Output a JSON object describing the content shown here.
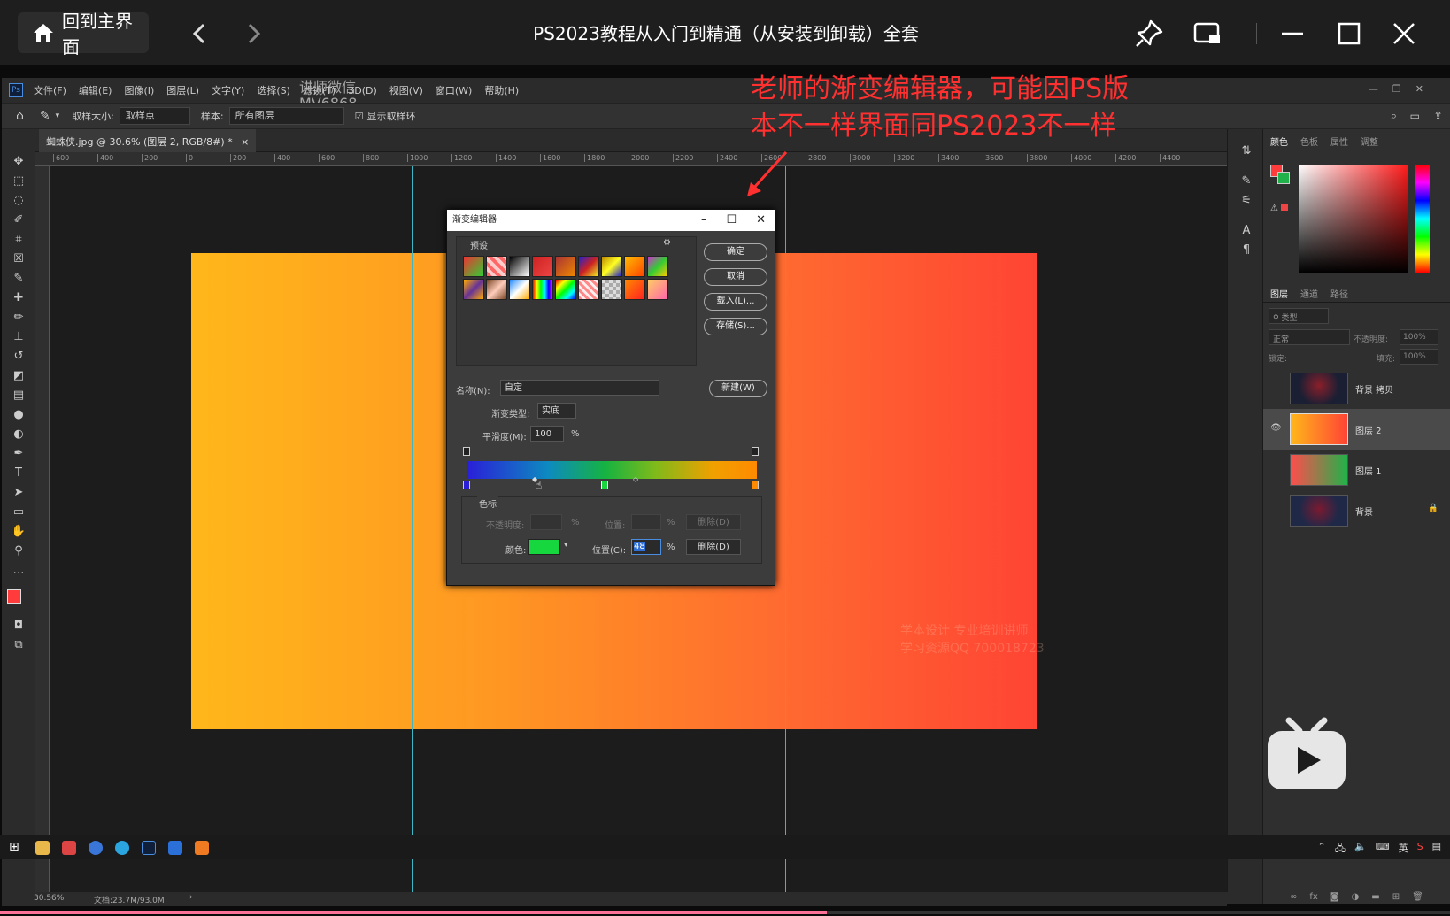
{
  "player": {
    "home_label": "回到主界面",
    "title": "PS2023教程从入门到精通（从安装到卸载）全套",
    "back_glyph": "‹",
    "forward_glyph": "›",
    "icons": [
      "home-icon",
      "chevron-left-icon",
      "chevron-right-icon",
      "pin-icon",
      "picture-in-picture-icon",
      "minimize-icon",
      "maximize-icon",
      "close-icon"
    ],
    "progress": 0.57
  },
  "annotation": {
    "line1": "老师的渐变编辑器，可能因PS版",
    "line2": "本不一样界面同PS2023不一样",
    "color": "#ff3030"
  },
  "ps": {
    "menu": [
      "文件(F)",
      "编辑(E)",
      "图像(I)",
      "图层(L)",
      "文字(Y)",
      "选择(S)",
      "滤镜(T)",
      "3D(D)",
      "视图(V)",
      "窗口(W)",
      "帮助(H)"
    ],
    "watermark": "讲师微信",
    "watermark2": "MV6868",
    "options": {
      "sample_size_label": "取样大小:",
      "sample_size_value": "取样点",
      "sample_label": "样本:",
      "sample_value": "所有图层",
      "show_ring": "显示取样环"
    },
    "doc_tab": "蜘蛛侠.jpg @ 30.6% (图层 2, RGB/8#) *",
    "ruler_ticks": [
      "600",
      "400",
      "200",
      "0",
      "200",
      "400",
      "600",
      "800",
      "1000",
      "1200",
      "1400",
      "1600",
      "1800",
      "2000",
      "2200",
      "2400",
      "2600",
      "2800",
      "3000",
      "3200",
      "3400",
      "3600",
      "3800",
      "4000",
      "4200",
      "4400"
    ],
    "status_zoom": "30.56%",
    "status_doc": "文档:23.7M/93.0M",
    "faint_watermark1": "学本设计 专业培训讲师",
    "faint_watermark2": "学习资源QQ 700018723",
    "panels": {
      "color_tabs": [
        "颜色",
        "色板",
        "属性",
        "调整"
      ],
      "layer_tabs": [
        "图层",
        "通道",
        "路径"
      ],
      "filter_label": "类型",
      "blend_mode": "正常",
      "opacity_label": "不透明度:",
      "opacity_value": "100%",
      "lock_label": "锁定:",
      "fill_label": "填充:",
      "fill_value": "100%",
      "layers": [
        {
          "name": "背景 拷贝",
          "visible": false,
          "selected": false
        },
        {
          "name": "图层 2",
          "visible": true,
          "selected": true
        },
        {
          "name": "图层 1",
          "visible": false,
          "selected": false
        },
        {
          "name": "背景",
          "visible": false,
          "selected": false
        }
      ]
    }
  },
  "dialog": {
    "title": "渐变编辑器",
    "presets_label": "预设",
    "ok": "确定",
    "cancel": "取消",
    "load": "载入(L)...",
    "save": "存储(S)...",
    "name_label": "名称(N):",
    "name_value": "自定",
    "new_button": "新建(W)",
    "gradient_type_label": "渐变类型:",
    "gradient_type_value": "实底",
    "smoothness_label": "平滑度(M):",
    "smoothness_value": "100",
    "percent": "%",
    "stops_group": "色标",
    "opacity_label": "不透明度:",
    "location_label": "位置:",
    "delete1": "删除(D)",
    "color_label": "颜色:",
    "location_c_label": "位置(C):",
    "location_c_value": "48",
    "delete2": "删除(D)",
    "swatch_color": "#17d73e"
  },
  "taskbar": {
    "ime": "英"
  }
}
